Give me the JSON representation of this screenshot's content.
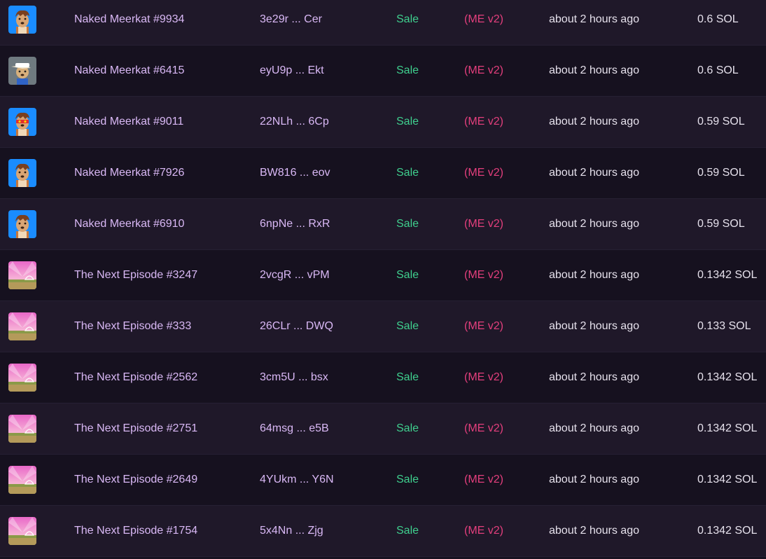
{
  "rows": [
    {
      "name": "Naked Meerkat #9934",
      "address": "3e29r ... Cer",
      "type": "Sale",
      "marketplace": "(ME v2)",
      "time": "about 2 hours ago",
      "price": "0.6 SOL",
      "thumb": "meerkat-blue"
    },
    {
      "name": "Naked Meerkat #6415",
      "address": "eyU9p ... Ekt",
      "type": "Sale",
      "marketplace": "(ME v2)",
      "time": "about 2 hours ago",
      "price": "0.6 SOL",
      "thumb": "meerkat-gray"
    },
    {
      "name": "Naked Meerkat #9011",
      "address": "22NLh ... 6Cp",
      "type": "Sale",
      "marketplace": "(ME v2)",
      "time": "about 2 hours ago",
      "price": "0.59 SOL",
      "thumb": "meerkat-blue-mask"
    },
    {
      "name": "Naked Meerkat #7926",
      "address": "BW816 ... eov",
      "type": "Sale",
      "marketplace": "(ME v2)",
      "time": "about 2 hours ago",
      "price": "0.59 SOL",
      "thumb": "meerkat-blue"
    },
    {
      "name": "Naked Meerkat #6910",
      "address": "6npNe ... RxR",
      "type": "Sale",
      "marketplace": "(ME v2)",
      "time": "about 2 hours ago",
      "price": "0.59 SOL",
      "thumb": "meerkat-blue"
    },
    {
      "name": "The Next Episode #3247",
      "address": "2vcgR ... vPM",
      "type": "Sale",
      "marketplace": "(ME v2)",
      "time": "about 2 hours ago",
      "price": "0.1342 SOL",
      "thumb": "episode"
    },
    {
      "name": "The Next Episode #333",
      "address": "26CLr ... DWQ",
      "type": "Sale",
      "marketplace": "(ME v2)",
      "time": "about 2 hours ago",
      "price": "0.133 SOL",
      "thumb": "episode"
    },
    {
      "name": "The Next Episode #2562",
      "address": "3cm5U ... bsx",
      "type": "Sale",
      "marketplace": "(ME v2)",
      "time": "about 2 hours ago",
      "price": "0.1342 SOL",
      "thumb": "episode"
    },
    {
      "name": "The Next Episode #2751",
      "address": "64msg ... e5B",
      "type": "Sale",
      "marketplace": "(ME v2)",
      "time": "about 2 hours ago",
      "price": "0.1342 SOL",
      "thumb": "episode"
    },
    {
      "name": "The Next Episode #2649",
      "address": "4YUkm ... Y6N",
      "type": "Sale",
      "marketplace": "(ME v2)",
      "time": "about 2 hours ago",
      "price": "0.1342 SOL",
      "thumb": "episode"
    },
    {
      "name": "The Next Episode #1754",
      "address": "5x4Nn ... Zjg",
      "type": "Sale",
      "marketplace": "(ME v2)",
      "time": "about 2 hours ago",
      "price": "0.1342 SOL",
      "thumb": "episode"
    }
  ],
  "colors": {
    "name": "#d9b8f5",
    "sale": "#3fcf8e",
    "marketplace": "#e43f7d",
    "text": "#e6e1ec",
    "row_even": "#1f1829",
    "row_odd": "#16111f"
  }
}
